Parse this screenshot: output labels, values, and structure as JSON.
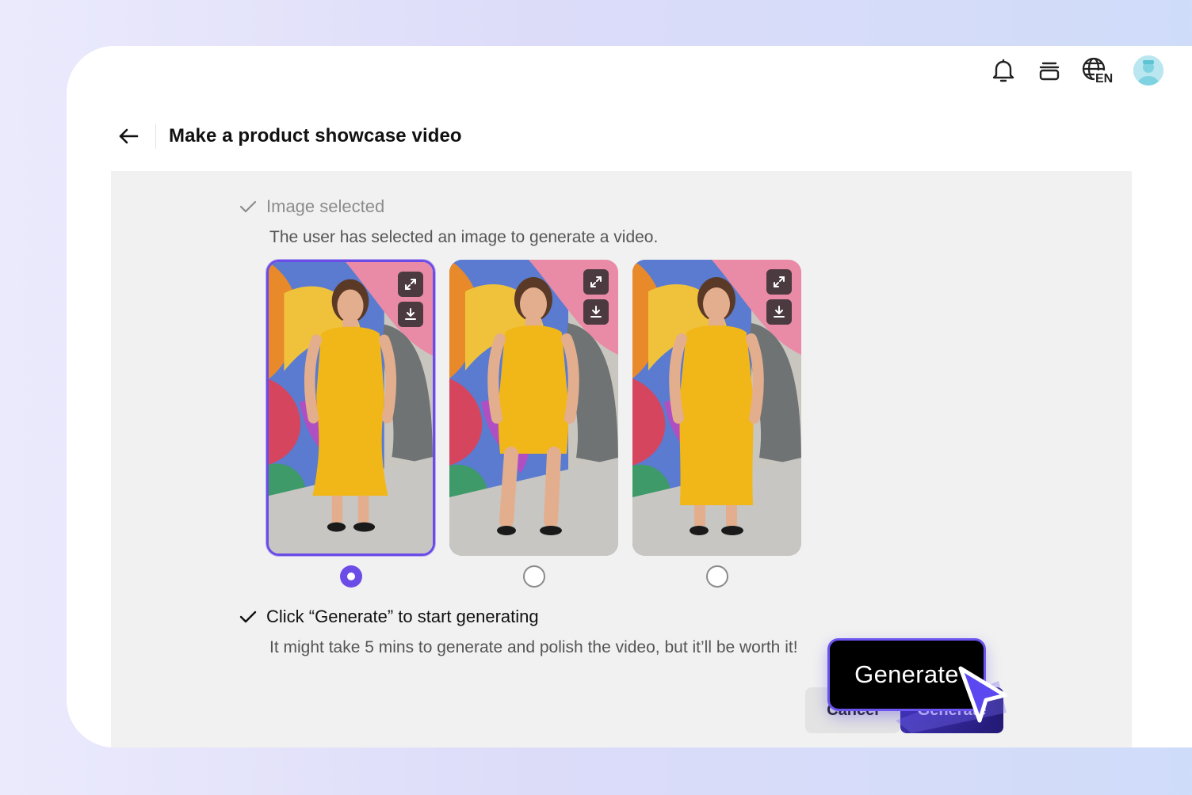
{
  "header": {
    "title": "Make a product showcase video"
  },
  "topbar": {
    "language_label": "EN"
  },
  "steps": [
    {
      "title": "Image selected",
      "description": "The user has selected an image to generate a video."
    },
    {
      "title": "Click “Generate” to start generating",
      "description": "It might take 5 mins to generate and polish the video, but it’ll be worth it!"
    }
  ],
  "images": [
    {
      "name": "image-option-1",
      "selected": true,
      "dress": "long-flowy"
    },
    {
      "name": "image-option-2",
      "selected": false,
      "dress": "short-satin"
    },
    {
      "name": "image-option-3",
      "selected": false,
      "dress": "long-midi"
    }
  ],
  "buttons": {
    "cancel_label": "Cancel",
    "generate_label": "Generate"
  },
  "callout": {
    "label": "Generate"
  },
  "colors": {
    "accent": "#6b4ce6",
    "dress": "#f1b719",
    "panel_bg": "#f1f1f1"
  }
}
